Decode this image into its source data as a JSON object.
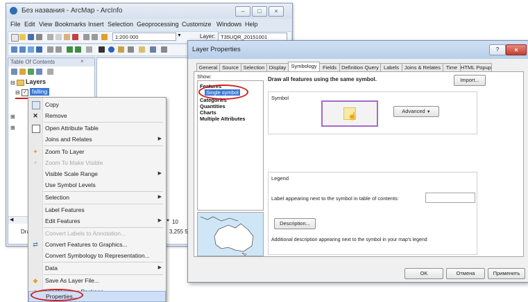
{
  "arcmap": {
    "title": "Без названия - ArcMap - ArcInfo",
    "menu": [
      "File",
      "Edit",
      "View",
      "Bookmarks",
      "Insert",
      "Selection",
      "Geoprocessing",
      "Customize",
      "Windows",
      "Help"
    ],
    "scale": "1:200 000",
    "layer_label": "Layer:",
    "layer_value": "T35UQR_20151001",
    "toc_title": "Table Of Contents",
    "toc_root": "Layers",
    "toc_layer": "falling",
    "status_left": "Dra",
    "status_right": "3,255  55",
    "font_size_field": "10"
  },
  "context_menu": {
    "items": [
      {
        "label": "Copy",
        "icon": "copy-icon",
        "disabled": false,
        "submenu": false
      },
      {
        "label": "Remove",
        "icon": "remove-icon",
        "disabled": false,
        "submenu": false
      },
      {
        "label": "Open Attribute Table",
        "icon": "table-icon",
        "disabled": false,
        "submenu": false
      },
      {
        "label": "Joins and Relates",
        "icon": "",
        "disabled": false,
        "submenu": true
      },
      {
        "label": "Zoom To Layer",
        "icon": "zoom-icon",
        "disabled": false,
        "submenu": false
      },
      {
        "label": "Zoom To Make Visible",
        "icon": "zoom-icon",
        "disabled": true,
        "submenu": false
      },
      {
        "label": "Visible Scale Range",
        "icon": "",
        "disabled": false,
        "submenu": true
      },
      {
        "label": "Use Symbol Levels",
        "icon": "",
        "disabled": false,
        "submenu": false
      },
      {
        "label": "Selection",
        "icon": "",
        "disabled": false,
        "submenu": true
      },
      {
        "label": "Label Features",
        "icon": "",
        "disabled": false,
        "submenu": false
      },
      {
        "label": "Edit Features",
        "icon": "",
        "disabled": false,
        "submenu": true
      },
      {
        "label": "Convert Labels to Annotation...",
        "icon": "",
        "disabled": true,
        "submenu": false
      },
      {
        "label": "Convert Features to Graphics...",
        "icon": "convert-icon",
        "disabled": false,
        "submenu": false
      },
      {
        "label": "Convert Symbology to Representation...",
        "icon": "",
        "disabled": false,
        "submenu": false
      },
      {
        "label": "Data",
        "icon": "",
        "disabled": false,
        "submenu": true
      },
      {
        "label": "Save As Layer File...",
        "icon": "save-layer-icon",
        "disabled": false,
        "submenu": false
      },
      {
        "label": "Create Layer Package...",
        "icon": "package-icon",
        "disabled": false,
        "submenu": false
      },
      {
        "label": "Properties...",
        "icon": "",
        "disabled": false,
        "submenu": false
      }
    ]
  },
  "dialog": {
    "title": "Layer Properties",
    "tabs": [
      "General",
      "Source",
      "Selection",
      "Display",
      "Symbology",
      "Fields",
      "Definition Query",
      "Labels",
      "Joins & Relates",
      "Time",
      "HTML Popup"
    ],
    "active_tab": "Symbology",
    "show_label": "Show:",
    "show_items": [
      "Features",
      "Single symbol",
      "Categories",
      "Quantities",
      "Charts",
      "Multiple Attributes"
    ],
    "description_heading": "Draw all features using the same symbol.",
    "import_button": "Import...",
    "symbol_group": "Symbol",
    "advanced_button": "Advanced",
    "legend_group": "Legend",
    "legend_label": "Label appearing next to the symbol in table of contents:",
    "description_button": "Description...",
    "description_note": "Additional description appearing next to the symbol in your map's legend",
    "ok_button": "OK",
    "cancel_button": "Отмена",
    "apply_button": "Применить"
  },
  "colors": {
    "highlight": "#d11a1a",
    "selection": "#3b78d8",
    "symbol_fill": "#f7e9a6"
  }
}
